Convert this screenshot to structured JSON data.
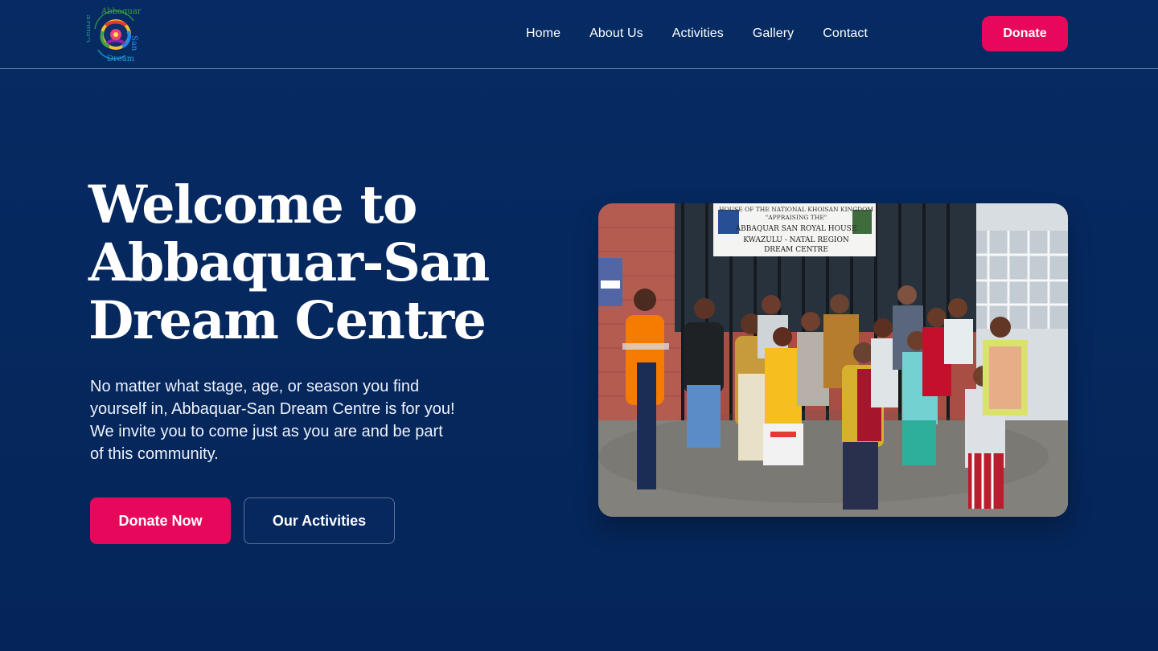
{
  "brand": {
    "logo_lettering": "Abbaquar-San Dream Centre"
  },
  "nav": {
    "items": [
      "Home",
      "About Us",
      "Activities",
      "Gallery",
      "Contact"
    ],
    "donate_label": "Donate"
  },
  "hero": {
    "title_lines": [
      "Welcome to",
      "Abbaquar-San",
      "Dream Centre"
    ],
    "description_lines": [
      "No matter what stage, age, or season you find",
      "yourself in, Abbaquar-San Dream Centre is for you!",
      "We invite you to come just as you are and be part",
      "of this community."
    ],
    "primary_button": "Donate Now",
    "secondary_button": "Our Activities"
  },
  "photo": {
    "sign_lines": [
      "HOUSE OF THE NATIONAL KHOISAN KINGDOM",
      "\"APPRAISING THE\"",
      "ABBAQUAR SAN ROYAL HOUSE",
      "KWAZULU - NATAL REGION",
      "DREAM CENTRE"
    ]
  },
  "colors": {
    "background": "#05265c",
    "accent": "#e8085b",
    "text": "#ffffff"
  }
}
